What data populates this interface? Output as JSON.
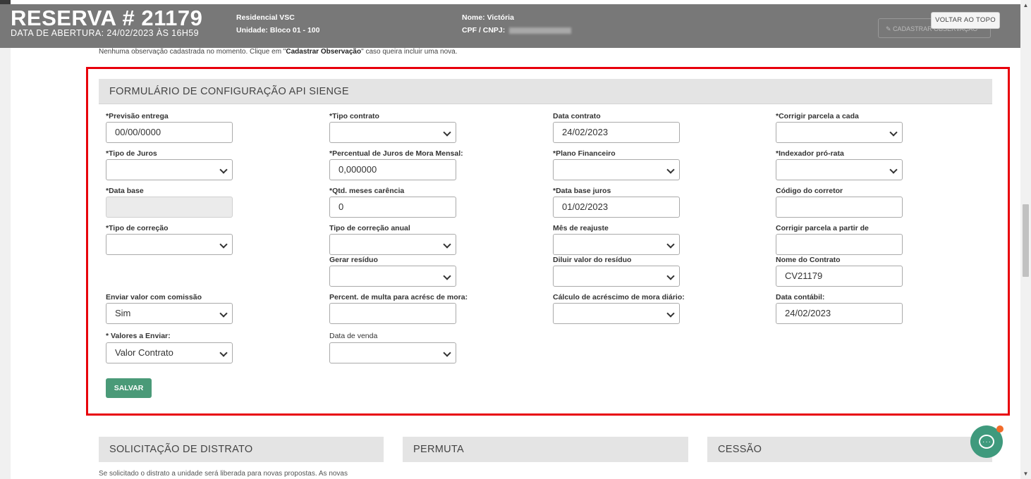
{
  "header": {
    "title": "RESERVA # 21179",
    "opened": "DATA DE ABERTURA: 24/02/2023 ÀS 16H59",
    "residencial_label": "Residencial VSC",
    "unidade_label": "Unidade:",
    "unidade_value": "Bloco 01 - 100",
    "nome_label": "Nome:",
    "nome_value": "Victória",
    "cpf_label": "CPF / CNPJ:",
    "back_to_top": "VOLTAR AO TOPO",
    "cadastrar_obs": "CADASTRAR OBSERVAÇÃO"
  },
  "note": {
    "before": "Nenhuma observação cadastrada no momento. Clique em \"",
    "strong": "Cadastrar Observação",
    "after": "\" caso queira incluir uma nova."
  },
  "form": {
    "title": "FORMULÁRIO DE CONFIGURAÇÃO API SIENGE",
    "fields": {
      "previsao_entrega": {
        "label": "*Previsão entrega",
        "value": "00/00/0000"
      },
      "tipo_contrato": {
        "label": "*Tipo contrato",
        "value": ""
      },
      "data_contrato": {
        "label": "Data contrato",
        "value": "24/02/2023"
      },
      "corrigir_parcela": {
        "label": "*Corrigir parcela a cada",
        "value": ""
      },
      "tipo_juros": {
        "label": "*Tipo de Juros",
        "value": ""
      },
      "percentual_juros": {
        "label": "*Percentual de Juros de Mora Mensal:",
        "value": "0,000000"
      },
      "plano_financeiro": {
        "label": "*Plano Financeiro",
        "value": ""
      },
      "indexador": {
        "label": "*Indexador pró-rata",
        "value": ""
      },
      "data_base": {
        "label": "*Data base",
        "value": ""
      },
      "meses_carencia": {
        "label": "*Qtd. meses carência",
        "value": "0"
      },
      "data_base_juros": {
        "label": "*Data base juros",
        "value": "01/02/2023"
      },
      "codigo_corretor": {
        "label": "Código do corretor",
        "value": ""
      },
      "tipo_correcao": {
        "label": "*Tipo de correção",
        "value": ""
      },
      "tipo_correcao_anual": {
        "label": "Tipo de correção anual",
        "value": ""
      },
      "mes_reajuste": {
        "label": "Mês de reajuste",
        "value": ""
      },
      "corrigir_partir": {
        "label": "Corrigir parcela a partir de",
        "value": ""
      },
      "gerar_residuo": {
        "label": "Gerar resíduo",
        "value": ""
      },
      "diluir_residuo": {
        "label": "Diluir valor do resíduo",
        "value": ""
      },
      "nome_contrato": {
        "label": "Nome do Contrato",
        "value": "CV21179"
      },
      "enviar_comissao": {
        "label": "Enviar valor com comissão",
        "value": "Sim"
      },
      "percent_multa": {
        "label": "Percent. de multa para acrésc de mora:",
        "value": ""
      },
      "calculo_mora": {
        "label": "Cálculo de acréscimo de mora diário:",
        "value": ""
      },
      "data_contabil": {
        "label": "Data contábil:",
        "value": "24/02/2023"
      },
      "valores_enviar": {
        "label": "* Valores a Enviar:",
        "value": "Valor Contrato"
      },
      "data_venda": {
        "label": "Data de venda",
        "value": ""
      }
    },
    "save_label": "SALVAR"
  },
  "sections": {
    "distrato": "SOLICITAÇÃO DE DISTRATO",
    "permuta": "PERMUTA",
    "cessao": "CESSÃO",
    "distrato_note": "Se solicitado o distrato a unidade será liberada para novas propostas. As novas"
  },
  "colors": {
    "header_bg": "#787878",
    "highlight_border": "#e8000b",
    "save_button": "#4a9a78",
    "chat_button": "#3f9a7d",
    "chat_badge": "#f26b2a"
  }
}
